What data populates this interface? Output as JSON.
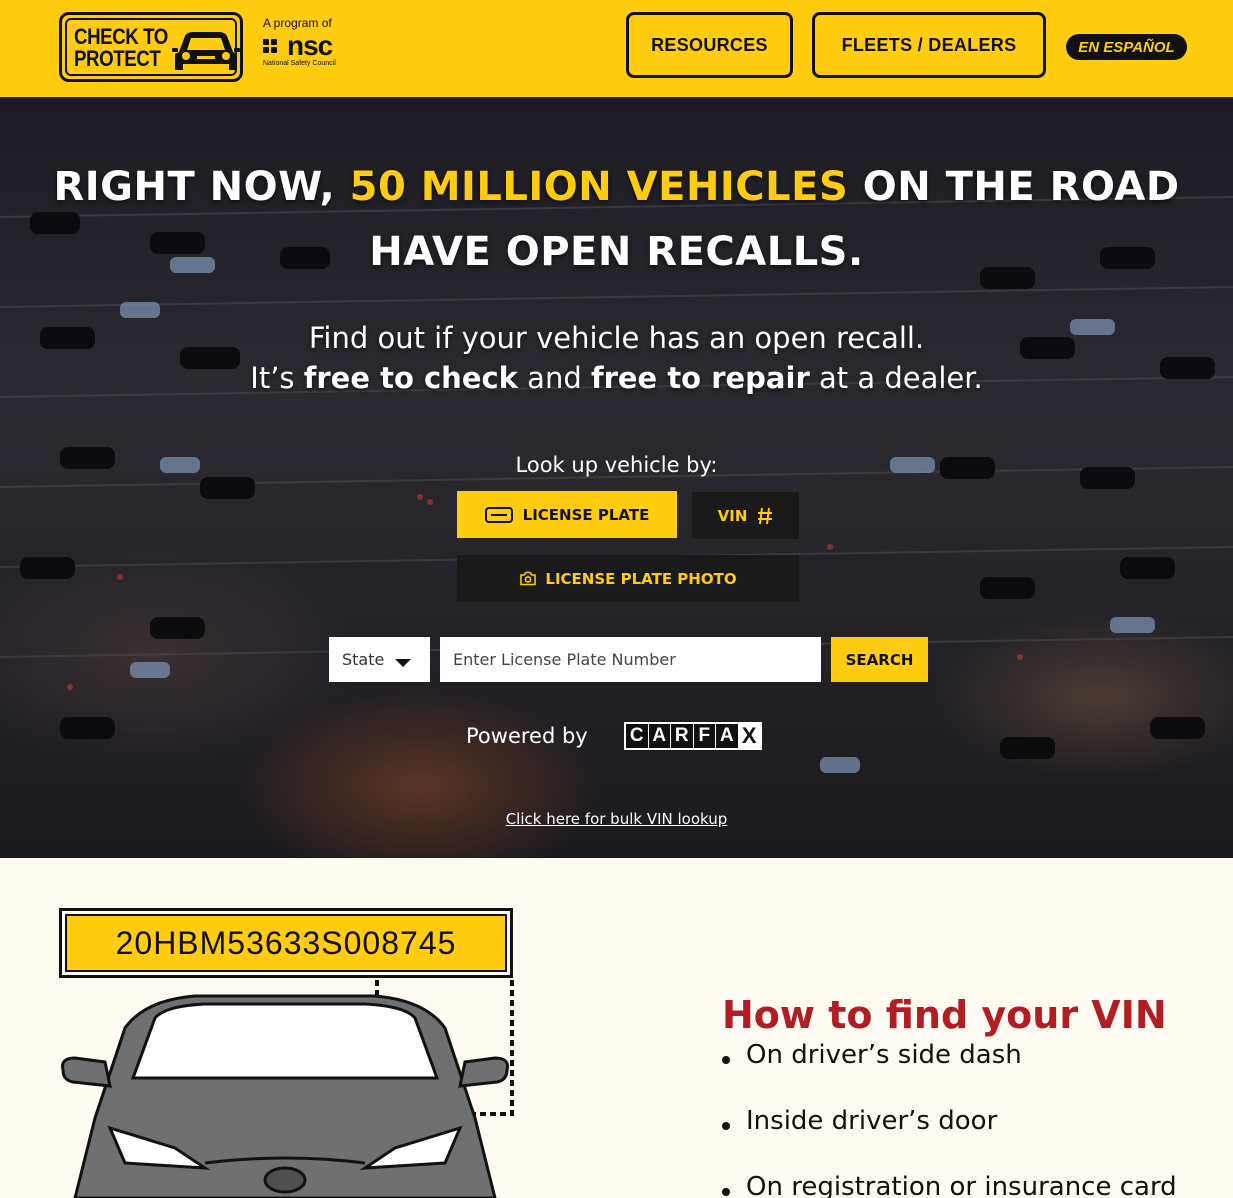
{
  "header": {
    "logo_text": [
      "CHECK TO",
      "PROTECT"
    ],
    "program_label": "A program of",
    "nsc_name": "nsc",
    "nsc_full": "National Safety Council",
    "nav": {
      "resources": "RESOURCES",
      "fleets": "FLEETS / DEALERS",
      "espanol": "EN ESPAÑOL"
    }
  },
  "hero": {
    "headline_pre": "RIGHT NOW, ",
    "headline_highlight": "50 MILLION VEHICLES",
    "headline_post": " ON THE ROAD",
    "headline_line2": "HAVE OPEN RECALLS.",
    "subline_1": "Find out if your vehicle has an open recall.",
    "subline_2_a": "It’s ",
    "subline_2_b": "free to check",
    "subline_2_c": " and ",
    "subline_2_d": "free to repair",
    "subline_2_e": " at a dealer.",
    "lookup_label": "Look up vehicle by:",
    "tabs": {
      "license_plate": "LICENSE PLATE",
      "vin": "VIN",
      "photo": "LICENSE PLATE PHOTO"
    },
    "selected_tab": "LICENSE PLATE",
    "state_select": "State",
    "plate_placeholder": "Enter License Plate Number",
    "search": "SEARCH",
    "powered_by": "Powered by",
    "carfax_letters": [
      "C",
      "A",
      "R",
      "F",
      "A",
      "X"
    ],
    "bulk_link": "Click here for bulk VIN lookup"
  },
  "vin_section": {
    "vin_example": "20HBM53633S008745",
    "title": "How to find your VIN",
    "items": [
      "On driver’s side dash",
      "Inside driver’s door",
      "On registration or insurance card"
    ]
  },
  "colors": {
    "brand_yellow": "#ffcc0f",
    "dark": "#111111",
    "title_red": "#b01d22",
    "page_bg": "#fffbf3"
  },
  "icons": [
    "car-icon",
    "license-plate-icon",
    "hash-icon",
    "camera-icon",
    "chevron-down-icon"
  ]
}
